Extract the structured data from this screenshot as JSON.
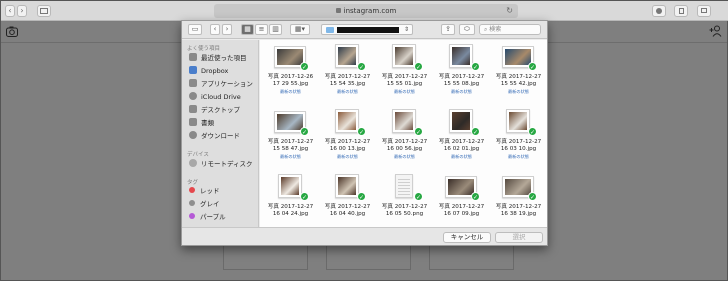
{
  "browser": {
    "address": "instagram.com",
    "nav_back": "‹",
    "nav_forward": "›"
  },
  "dialog": {
    "search_placeholder": "検索",
    "folder_name_redacted": true,
    "sidebar": {
      "favorites_head": "よく使う項目",
      "favorites": [
        "最近使った項目",
        "Dropbox",
        "アプリケーション",
        "iCloud Drive",
        "デスクトップ",
        "書類",
        "ダウンロード"
      ],
      "devices_head": "デバイス",
      "devices": [
        "リモートディスク"
      ],
      "tags_head": "タグ",
      "tags": [
        {
          "label": "レッド",
          "color": "#e5484d"
        },
        {
          "label": "グレイ",
          "color": "#8e8e8e"
        },
        {
          "label": "パープル",
          "color": "#b55ad6"
        }
      ]
    },
    "files": [
      {
        "line1": "写真 2017-12-26",
        "line2": "17 29 55.jpg",
        "status": "最新の状態"
      },
      {
        "line1": "写真 2017-12-27",
        "line2": "15 54 35.jpg",
        "status": "最新の状態"
      },
      {
        "line1": "写真 2017-12-27",
        "line2": "15 55 01.jpg",
        "status": "最新の状態"
      },
      {
        "line1": "写真 2017-12-27",
        "line2": "15 55 08.jpg",
        "status": "最新の状態"
      },
      {
        "line1": "写真 2017-12-27",
        "line2": "15 55 42.jpg",
        "status": "最新の状態"
      },
      {
        "line1": "写真 2017-12-27",
        "line2": "15 58 47.jpg",
        "status": "最新の状態"
      },
      {
        "line1": "写真 2017-12-27",
        "line2": "16 00 13.jpg",
        "status": "最新の状態"
      },
      {
        "line1": "写真 2017-12-27",
        "line2": "16 00 56.jpg",
        "status": "最新の状態"
      },
      {
        "line1": "写真 2017-12-27",
        "line2": "16 02 01.jpg",
        "status": "最新の状態"
      },
      {
        "line1": "写真 2017-12-27",
        "line2": "16 03 10.jpg",
        "status": "最新の状態"
      },
      {
        "line1": "写真 2017-12-27",
        "line2": "16 04 24.jpg",
        "status": ""
      },
      {
        "line1": "写真 2017-12-27",
        "line2": "16 04 40.jpg",
        "status": ""
      },
      {
        "line1": "写真 2017-12-27",
        "line2": "16 05 50.png",
        "status": ""
      },
      {
        "line1": "写真 2017-12-27",
        "line2": "16 07 09.jpg",
        "status": ""
      },
      {
        "line1": "写真 2017-12-27",
        "line2": "16 38 19.jpg",
        "status": ""
      }
    ],
    "cancel_label": "キャンセル",
    "select_label": "選択"
  },
  "colors": {
    "check_green": "#27a843",
    "status_blue": "#3a6fb8",
    "overlay_bar_blue": "#2a5a9e"
  }
}
